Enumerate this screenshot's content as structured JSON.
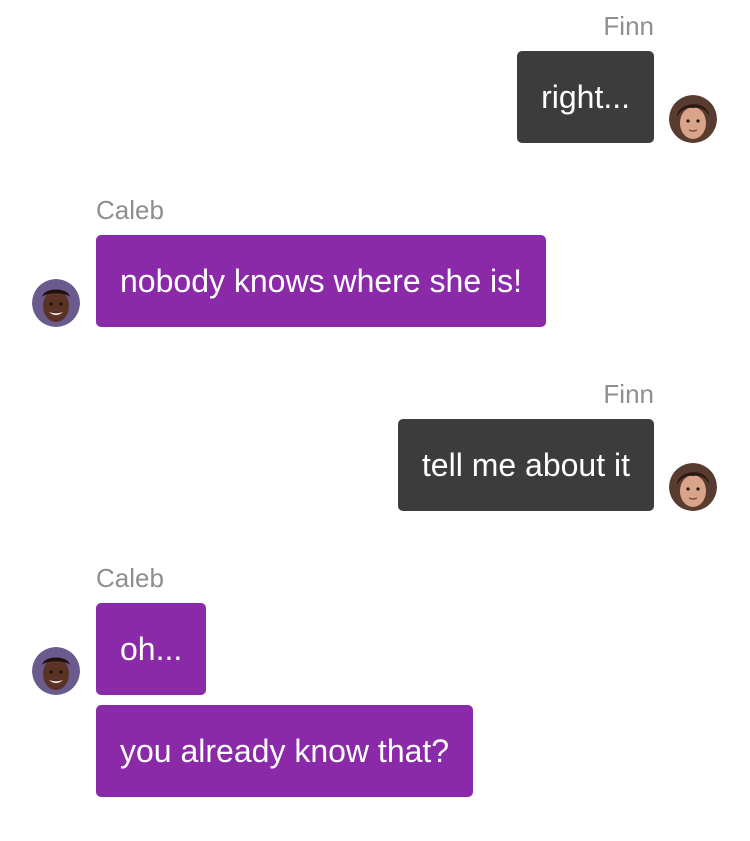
{
  "conversation": {
    "messages": [
      {
        "sender": "Finn",
        "text": "right..."
      },
      {
        "sender": "Caleb",
        "text": "nobody knows where she is!"
      },
      {
        "sender": "Finn",
        "text": "tell me about it"
      },
      {
        "sender": "Caleb",
        "text": "oh..."
      },
      {
        "sender": "Caleb",
        "text": "you already know that?"
      }
    ]
  },
  "avatars": {
    "finn": "finn-avatar-icon",
    "caleb": "caleb-avatar-icon"
  },
  "colors": {
    "finn_bubble": "#3c3c3c",
    "caleb_bubble": "#8b2aa8",
    "sender_label": "#8e8e93",
    "text": "#ffffff",
    "background": "#ffffff"
  }
}
